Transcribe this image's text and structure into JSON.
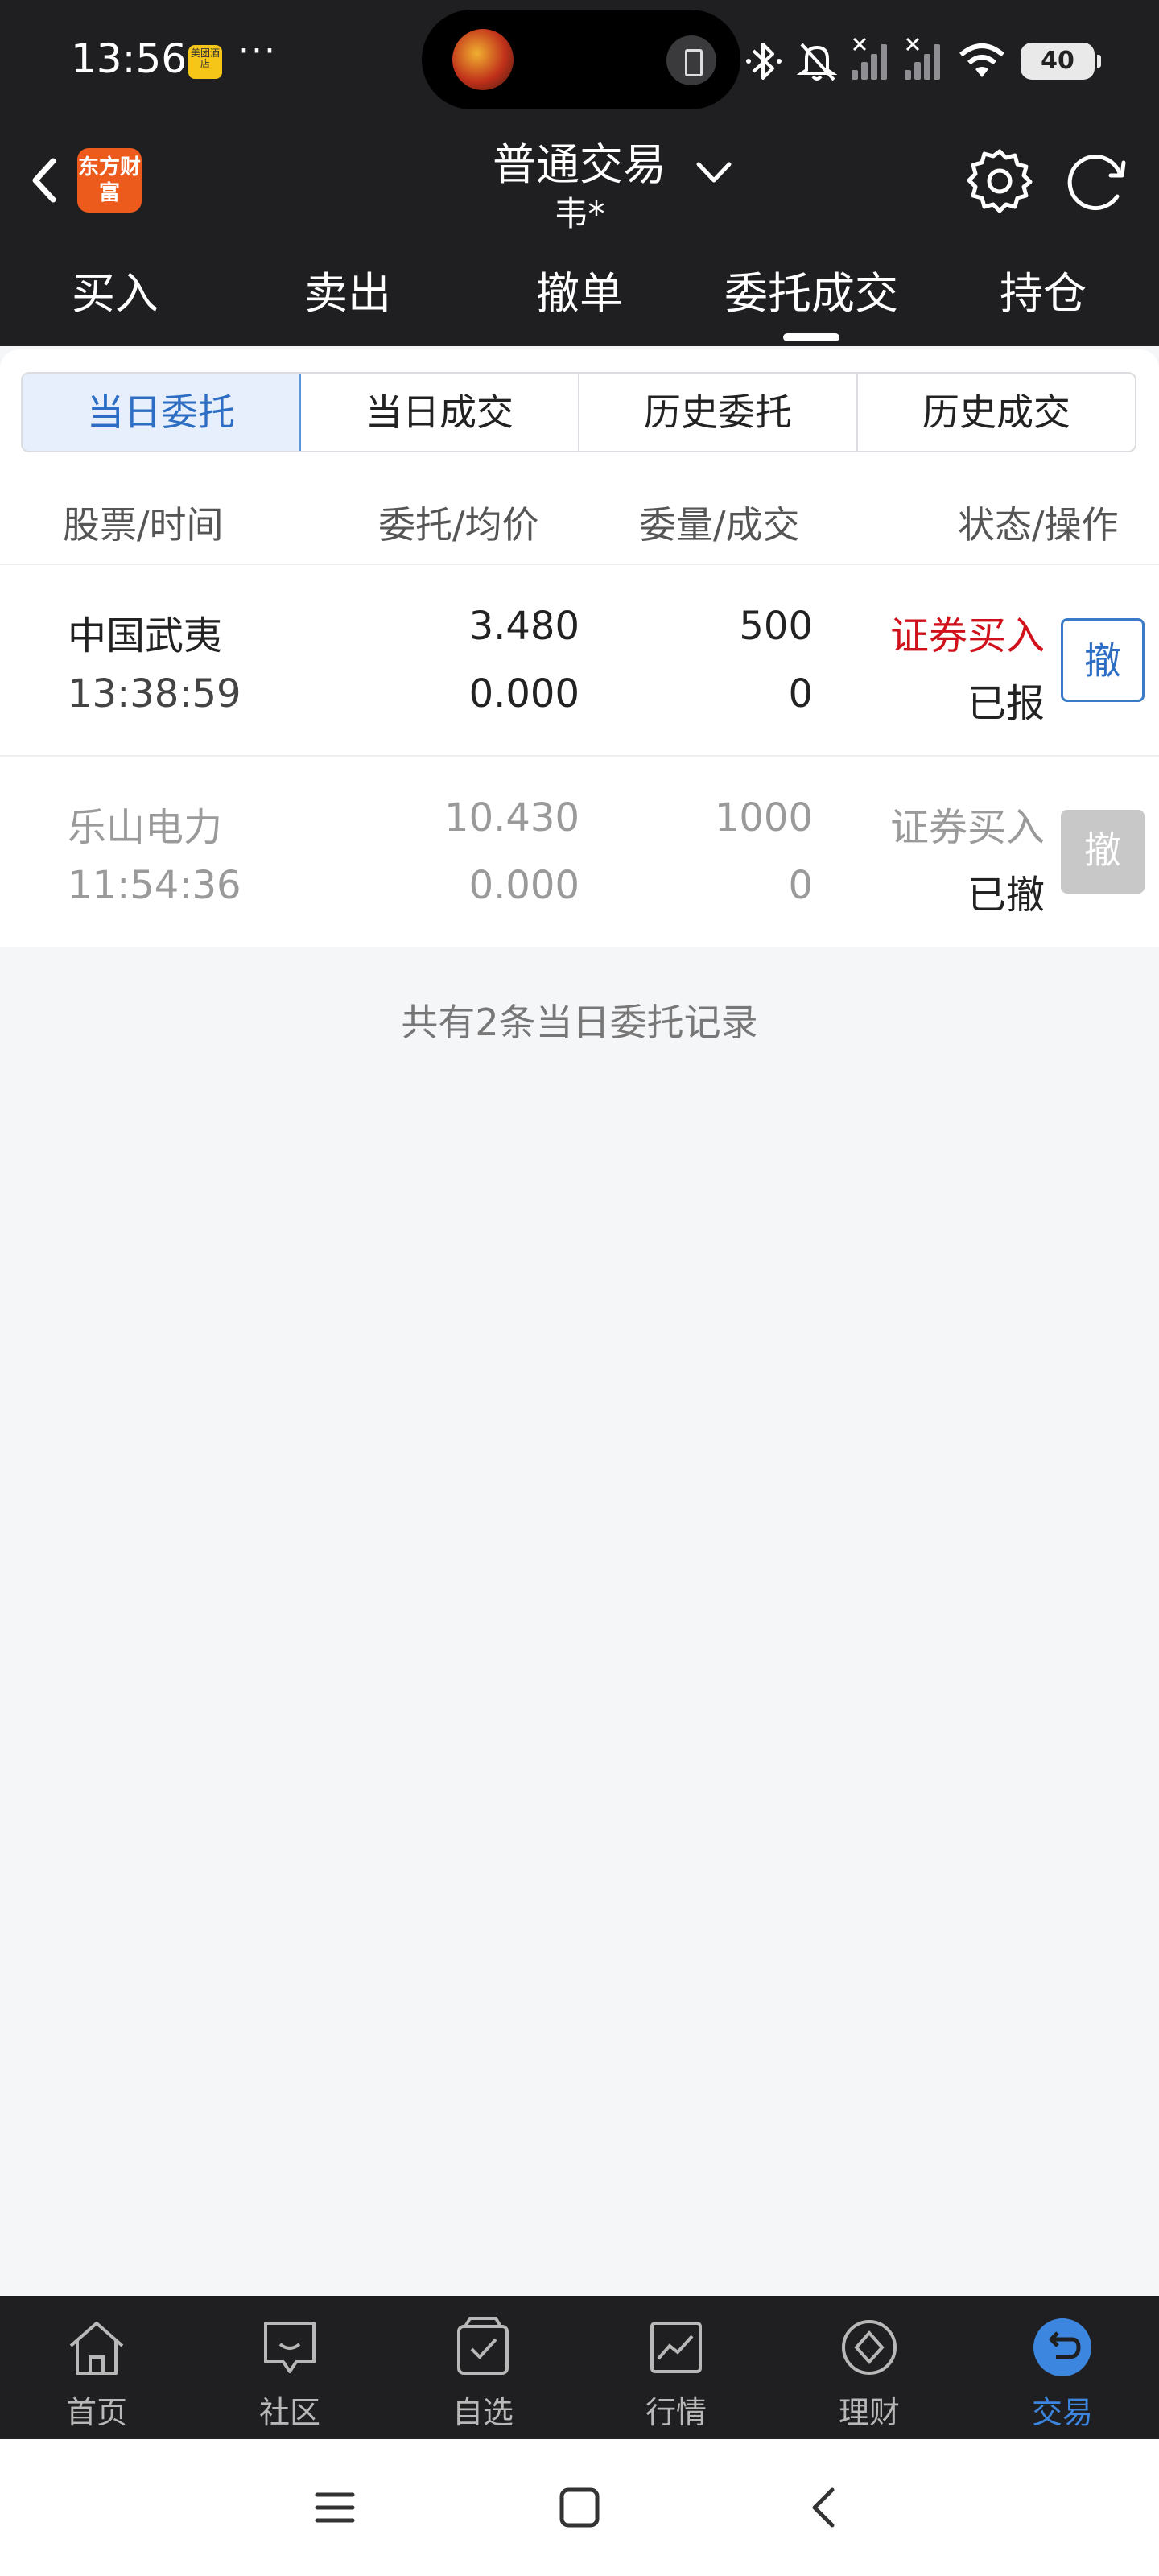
{
  "status_bar": {
    "time": "13:56",
    "app_badge": "美团酒店",
    "more": "···",
    "battery": "40"
  },
  "header": {
    "logo_text": "东方财富",
    "title": "普通交易",
    "account": "韦*"
  },
  "main_tabs": [
    {
      "label": "买入",
      "active": false
    },
    {
      "label": "卖出",
      "active": false
    },
    {
      "label": "撤单",
      "active": false
    },
    {
      "label": "委托成交",
      "active": true
    },
    {
      "label": "持仓",
      "active": false
    }
  ],
  "sub_tabs": [
    {
      "label": "当日委托",
      "active": true
    },
    {
      "label": "当日成交",
      "active": false
    },
    {
      "label": "历史委托",
      "active": false
    },
    {
      "label": "历史成交",
      "active": false
    }
  ],
  "columns": [
    "股票/时间",
    "委托/均价",
    "委量/成交",
    "状态/操作"
  ],
  "orders": [
    {
      "name": "中国武夷",
      "time": "13:38:59",
      "price": "3.480",
      "avg_price": "0.000",
      "quantity": "500",
      "filled": "0",
      "direction": "证券买入",
      "status": "已报",
      "cancel_label": "撤",
      "cancelable": true
    },
    {
      "name": "乐山电力",
      "time": "11:54:36",
      "price": "10.430",
      "avg_price": "0.000",
      "quantity": "1000",
      "filled": "0",
      "direction": "证券买入",
      "status": "已撤",
      "cancel_label": "撤",
      "cancelable": false
    }
  ],
  "summary": "共有2条当日委托记录",
  "bottom_nav": [
    {
      "label": "首页",
      "icon": "home-icon",
      "active": false
    },
    {
      "label": "社区",
      "icon": "chat-icon",
      "active": false
    },
    {
      "label": "自选",
      "icon": "watchlist-icon",
      "active": false
    },
    {
      "label": "行情",
      "icon": "chart-icon",
      "active": false
    },
    {
      "label": "理财",
      "icon": "wealth-icon",
      "active": false
    },
    {
      "label": "交易",
      "icon": "trade-icon",
      "active": true
    }
  ],
  "colors": {
    "dark_bg": "#1f1f21",
    "accent_blue": "#2d6ec4",
    "buy_red": "#d0101a",
    "muted_gray": "#9a9a9a",
    "logo_orange": "#ec5a1c"
  }
}
